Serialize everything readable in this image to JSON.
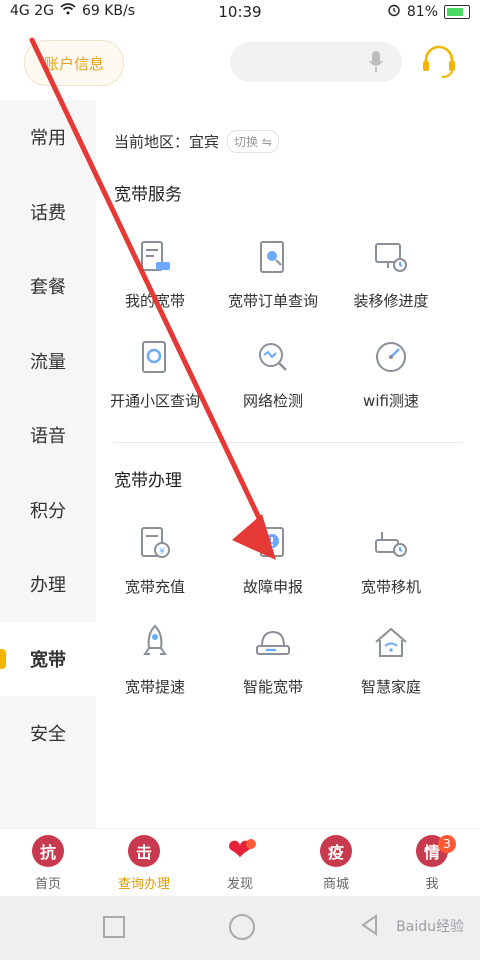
{
  "status_bar": {
    "signals": "4G 2G",
    "speed": "69 KB/s",
    "time": "10:39",
    "battery": "81%"
  },
  "header": {
    "account_label": "账户信息",
    "search_placeholder": ""
  },
  "left_nav": {
    "items": [
      {
        "label": "常用"
      },
      {
        "label": "话费"
      },
      {
        "label": "套餐"
      },
      {
        "label": "流量"
      },
      {
        "label": "语音"
      },
      {
        "label": "积分"
      },
      {
        "label": "办理"
      },
      {
        "label": "宽带"
      },
      {
        "label": "安全"
      }
    ]
  },
  "main": {
    "region_label": "当前地区：宜宾",
    "switch_label": "切换",
    "service_section": {
      "title": "宽带服务",
      "items": [
        {
          "label": "我的宽带",
          "icon": "broadband-icon"
        },
        {
          "label": "宽带订单查询",
          "icon": "order-search-icon"
        },
        {
          "label": "装移修进度",
          "icon": "progress-icon"
        },
        {
          "label": "开通小区查询",
          "icon": "community-search-icon"
        },
        {
          "label": "网络检测",
          "icon": "network-check-icon"
        },
        {
          "label": "wifi测速",
          "icon": "speedometer-icon"
        }
      ]
    },
    "handle_section": {
      "title": "宽带办理",
      "items": [
        {
          "label": "宽带充值",
          "icon": "recharge-icon"
        },
        {
          "label": "故障申报",
          "icon": "fault-report-icon"
        },
        {
          "label": "宽带移机",
          "icon": "move-icon"
        },
        {
          "label": "宽带提速",
          "icon": "rocket-icon"
        },
        {
          "label": "智能宽带",
          "icon": "router-icon"
        },
        {
          "label": "智慧家庭",
          "icon": "home-icon"
        }
      ]
    }
  },
  "bottom_nav": {
    "tabs": [
      {
        "label": "首页",
        "glyph": "抗"
      },
      {
        "label": "查询办理",
        "glyph": "击"
      },
      {
        "label": "发现",
        "glyph": "❤"
      },
      {
        "label": "商城",
        "glyph": "疫"
      },
      {
        "label": "我",
        "glyph": "情",
        "count": "3"
      }
    ]
  },
  "watermark": {
    "text": "Baidu经验"
  },
  "colors": {
    "accent": "#e39b00",
    "badge": "#c83a4e",
    "arrow": "#e53935"
  }
}
